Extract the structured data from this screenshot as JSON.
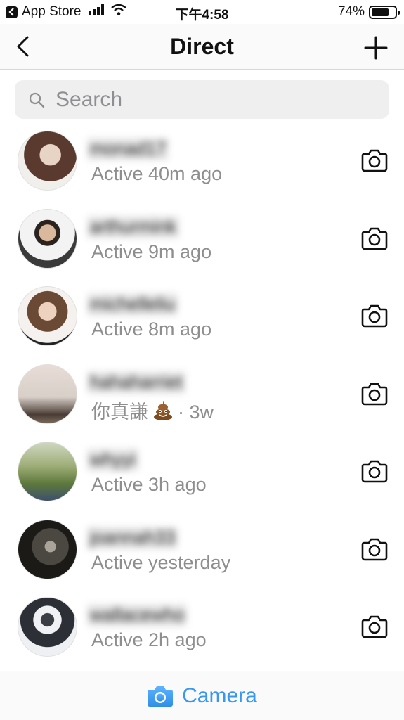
{
  "status_bar": {
    "back_app": "App Store",
    "time": "下午4:58",
    "battery_percent": "74%",
    "battery_level": 0.74
  },
  "nav": {
    "title": "Direct",
    "back_icon": "chevron-left-icon",
    "add_icon": "plus-icon"
  },
  "search": {
    "placeholder": "Search",
    "value": ""
  },
  "threads": [
    {
      "username": "monad17",
      "status": "Active 40m ago"
    },
    {
      "username": "arthurmink",
      "status": "Active 9m ago"
    },
    {
      "username": "michelleliu",
      "status": "Active 8m ago"
    },
    {
      "username": "hahaharriet",
      "status_text": "你真謙",
      "status_time": "· 3w"
    },
    {
      "username": "whyyi",
      "status": "Active 3h ago"
    },
    {
      "username": "joannah33",
      "status": "Active yesterday"
    },
    {
      "username": "wallacewho",
      "status": "Active 2h ago"
    }
  ],
  "bottom_bar": {
    "camera_label": "Camera",
    "accent_color": "#3897f0"
  }
}
